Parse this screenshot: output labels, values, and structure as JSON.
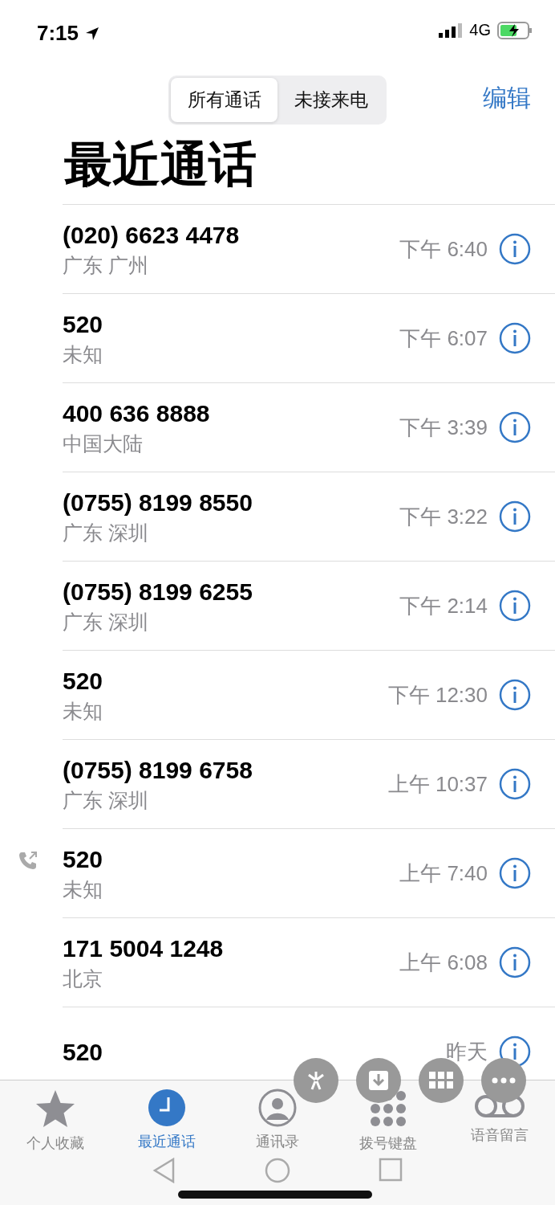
{
  "status_bar": {
    "time": "7:15",
    "network": "4G"
  },
  "segments": [
    {
      "label": "所有通话",
      "selected": true
    },
    {
      "label": "未接来电",
      "selected": false
    }
  ],
  "edit": "编辑",
  "title": "最近通话",
  "calls": [
    {
      "number": "(020) 6623 4478",
      "location": "广东 广州",
      "time": "下午 6:40",
      "outgoing": false
    },
    {
      "number": "520",
      "location": "未知",
      "time": "下午 6:07",
      "outgoing": false
    },
    {
      "number": "400 636 8888",
      "location": "中国大陆",
      "time": "下午 3:39",
      "outgoing": false
    },
    {
      "number": "(0755) 8199 8550",
      "location": "广东 深圳",
      "time": "下午 3:22",
      "outgoing": false
    },
    {
      "number": "(0755) 8199 6255",
      "location": "广东 深圳",
      "time": "下午 2:14",
      "outgoing": false
    },
    {
      "number": "520",
      "location": "未知",
      "time": "下午 12:30",
      "outgoing": false
    },
    {
      "number": "(0755) 8199 6758",
      "location": "广东 深圳",
      "time": "上午 10:37",
      "outgoing": false
    },
    {
      "number": "520",
      "location": "未知",
      "time": "上午 7:40",
      "outgoing": true
    },
    {
      "number": "171 5004 1248",
      "location": "北京",
      "time": "上午 6:08",
      "outgoing": false
    },
    {
      "number": "520",
      "time": "昨天",
      "outgoing": false
    }
  ],
  "tabs": [
    {
      "kind": "favorites",
      "label": "个人收藏",
      "selected": false
    },
    {
      "kind": "recents",
      "label": "最近通话",
      "selected": true
    },
    {
      "kind": "contacts",
      "label": "通讯录",
      "selected": false
    },
    {
      "kind": "keypad",
      "label": "拨号键盘",
      "selected": false
    },
    {
      "kind": "voicemail",
      "label": "语音留言",
      "selected": false
    }
  ]
}
